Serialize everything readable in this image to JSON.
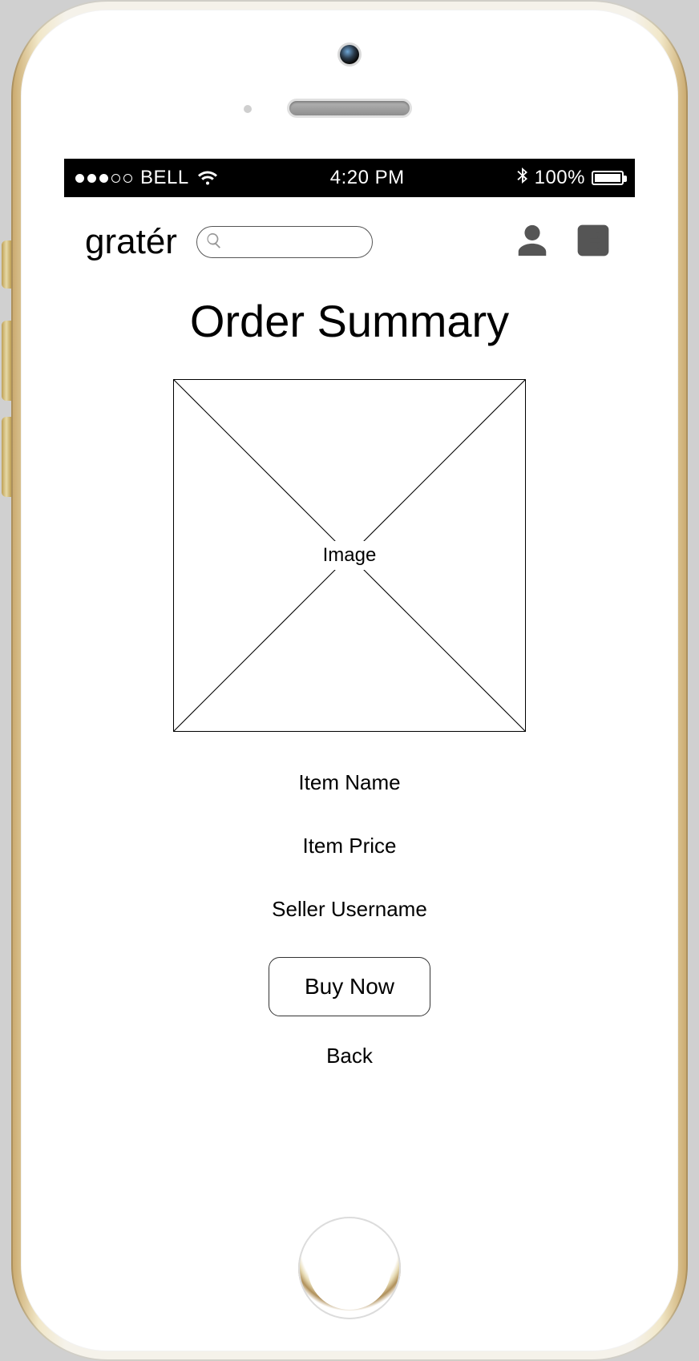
{
  "statusbar": {
    "carrier": "BELL",
    "time": "4:20 PM",
    "battery_pct": "100%",
    "signal_filled": 3,
    "signal_total": 5
  },
  "header": {
    "brand": "gratér",
    "search_placeholder": ""
  },
  "page": {
    "title": "Order Summary",
    "image_label": "Image",
    "item_name": "Item Name",
    "item_price": "Item Price",
    "seller": "Seller Username",
    "buy_label": "Buy Now",
    "back_label": "Back"
  }
}
